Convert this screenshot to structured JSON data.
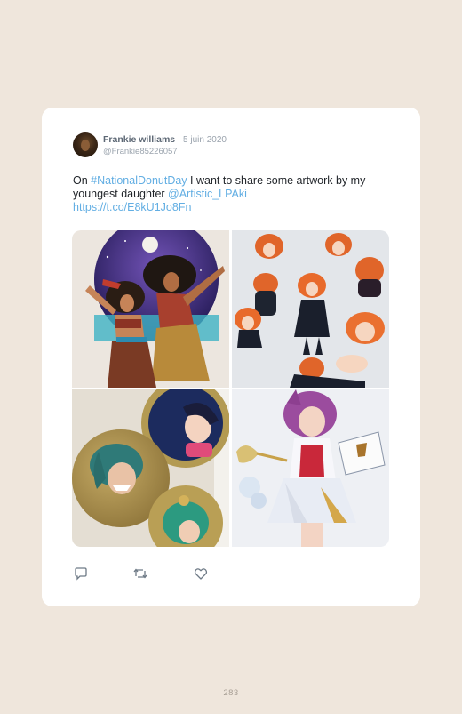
{
  "tweet": {
    "author": {
      "display_name": "Frankie williams",
      "separator": " · ",
      "date": "5 juin 2020",
      "handle": "@Frankie85226057"
    },
    "text": {
      "part1": "On ",
      "hashtag": "#NationalDonutDay",
      "part2": " I want to share some artwork by my youngest daughter ",
      "mention": "@Artistic_LPAki",
      "url": "https://t.co/E8kU1Jo8Fn"
    },
    "photos": [
      {
        "icon": "artwork-photo-1"
      },
      {
        "icon": "artwork-photo-2"
      },
      {
        "icon": "artwork-photo-3"
      },
      {
        "icon": "artwork-photo-4"
      }
    ],
    "actions": [
      {
        "icon": "reply-icon"
      },
      {
        "icon": "retweet-icon"
      },
      {
        "icon": "like-icon"
      }
    ]
  },
  "page": {
    "number": "283"
  },
  "colors": {
    "background": "#efe6dc",
    "link": "#62aee3",
    "name": "#5d6875",
    "muted": "#9aa3ad"
  }
}
